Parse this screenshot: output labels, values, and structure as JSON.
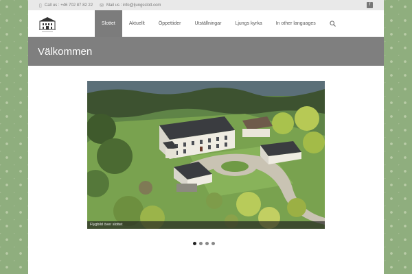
{
  "topbar": {
    "phone": "Call us : +46 702 87 82 22",
    "email": "Mail us : info@ljungsslott.com",
    "phone_icon": "phone-icon",
    "email_icon": "envelope-icon",
    "social_icon": "social-icon"
  },
  "nav": {
    "items": [
      {
        "label": "Slottet",
        "active": true
      },
      {
        "label": "Aktuellt"
      },
      {
        "label": "Öppettider"
      },
      {
        "label": "Utställningar"
      },
      {
        "label": "Ljungs kyrka"
      },
      {
        "label": "In other languages"
      }
    ],
    "search_icon": "search-icon"
  },
  "banner": {
    "title": "Välkommen"
  },
  "slider": {
    "caption": "Flygbild över slottet",
    "slides": 4,
    "active_index": 0
  },
  "colors": {
    "accent": "#7c7c7c",
    "background_pattern": "#8fae7e",
    "topbar": "#e9e9e9"
  }
}
